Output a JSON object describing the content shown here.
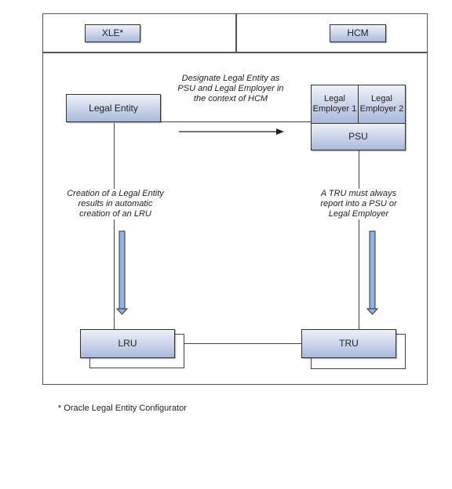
{
  "header": {
    "left_label": "XLE*",
    "right_label": "HCM"
  },
  "nodes": {
    "legal_entity": "Legal Entity",
    "legal_employer_1": "Legal Employer 1",
    "legal_employer_2": "Legal Employer 2",
    "psu": "PSU",
    "lru": "LRU",
    "tru": "TRU"
  },
  "notes": {
    "designate": "Designate Legal Entity as PSU and Legal Employer in the context of HCM",
    "creation": "Creation of a Legal Entity results in automatic creation of an LRU",
    "tru_rule": "A TRU must always report into a PSU or Legal Employer"
  },
  "footnote": "* Oracle Legal Entity Configurator",
  "colors": {
    "box_top": "#eef1f8",
    "box_bottom": "#a9b9dc",
    "arrow_fill": "#8fb3e3",
    "line": "#444444"
  }
}
